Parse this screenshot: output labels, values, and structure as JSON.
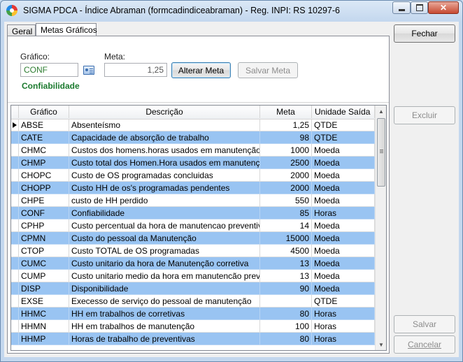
{
  "window": {
    "title": "SIGMA PDCA - Índice Abraman  (formcadindiceabraman)  - Reg. INPI: RS 10297-6"
  },
  "tabs": [
    {
      "label": "Geral"
    },
    {
      "label": "Metas Gráficos"
    }
  ],
  "form": {
    "grafico_label": "Gráfico:",
    "grafico_value": "CONF",
    "meta_label": "Meta:",
    "meta_value": "1,25",
    "alterar_label": "Alterar Meta",
    "salvar_meta_label": "Salvar Meta",
    "description": "Confiabilidade"
  },
  "table": {
    "headers": [
      "Gráfico",
      "Descrição",
      "Meta",
      "Unidade Saída"
    ],
    "rows": [
      {
        "g": "ABSE",
        "d": "Absenteísmo",
        "m": "1,25",
        "u": "QTDE"
      },
      {
        "g": "CATE",
        "d": "Capacidade de absorção de trabalho",
        "m": "98",
        "u": "QTDE"
      },
      {
        "g": "CHMC",
        "d": "Custos dos homens.horas usados em manutenção correti",
        "m": "1000",
        "u": "Moeda"
      },
      {
        "g": "CHMP",
        "d": "Custo total dos Homen.Hora usados em manutenção prev",
        "m": "2500",
        "u": "Moeda"
      },
      {
        "g": "CHOPC",
        "d": "Custo de OS programadas concluidas",
        "m": "2000",
        "u": "Moeda"
      },
      {
        "g": "CHOPP",
        "d": "Custo HH de os's programadas pendentes",
        "m": "2000",
        "u": "Moeda"
      },
      {
        "g": "CHPE",
        "d": "custo de HH perdido",
        "m": "550",
        "u": "Moeda"
      },
      {
        "g": "CONF",
        "d": "Confiabilidade",
        "m": "85",
        "u": "Horas"
      },
      {
        "g": "CPHP",
        "d": "Custo percentual da hora de manutencao preventiva",
        "m": "14",
        "u": "Moeda"
      },
      {
        "g": "CPMN",
        "d": "Custo do pessoal da Manutenção",
        "m": "15000",
        "u": "Moeda"
      },
      {
        "g": "CTOP",
        "d": "Custo TOTAL de OS programadas",
        "m": "4500",
        "u": "Moeda"
      },
      {
        "g": "CUMC",
        "d": "Custo unitario da hora de Manutenção corretiva",
        "m": "13",
        "u": "Moeda"
      },
      {
        "g": "CUMP",
        "d": "Custo unitario medio da hora em manutencão preventiva",
        "m": "13",
        "u": "Moeda"
      },
      {
        "g": "DISP",
        "d": "Disponibilidade",
        "m": "90",
        "u": "Moeda"
      },
      {
        "g": "EXSE",
        "d": "Execesso de serviço do pessoal de manutenção",
        "m": "",
        "u": "QTDE"
      },
      {
        "g": "HHMC",
        "d": "HH em trabalhos de corretivas",
        "m": "80",
        "u": "Horas"
      },
      {
        "g": "HHMN",
        "d": "HH em trabalhos de manutenção",
        "m": "100",
        "u": "Horas"
      },
      {
        "g": "HHMP",
        "d": "Horas de trabalho de preventivas",
        "m": "80",
        "u": "Horas"
      }
    ]
  },
  "right_buttons": {
    "fechar": "Fechar",
    "excluir": "Excluir",
    "salvar": "Salvar",
    "cancelar": "Cancelar"
  },
  "icons": {
    "app": "sigma-app-icon",
    "lookup": "lookup-icon",
    "row_indicator": "current-row-arrow-icon"
  },
  "colors": {
    "alt_row": "#99c4f2",
    "description_text": "#1b7a2e",
    "grafico_text": "#2e7d32"
  }
}
